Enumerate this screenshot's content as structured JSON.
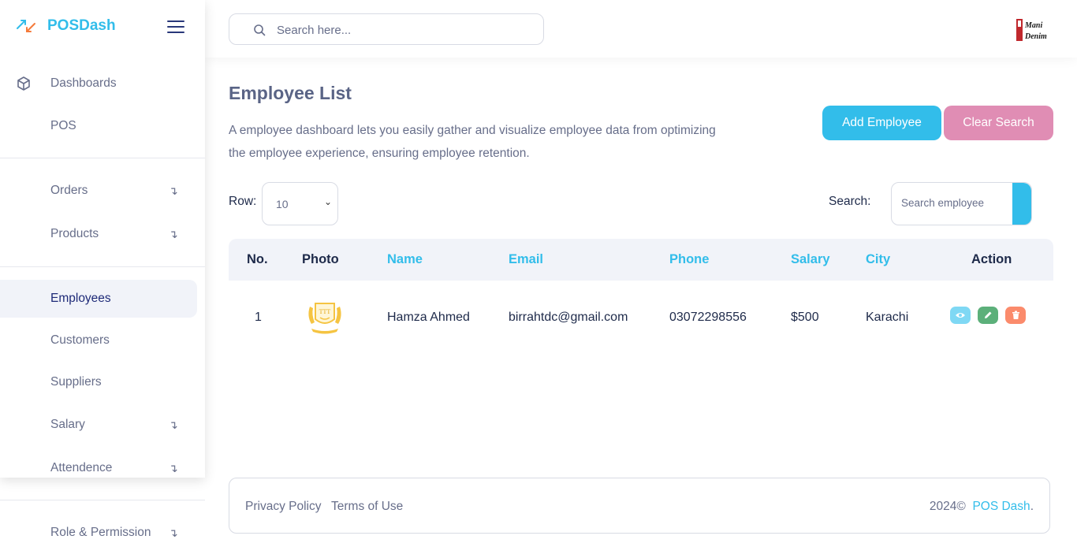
{
  "brand": {
    "name": "POSDash",
    "accent": "#32bdea"
  },
  "sidebar": {
    "items": [
      {
        "label": "Dashboards",
        "arrow": ""
      },
      {
        "label": "POS",
        "arrow": ""
      },
      {
        "label": "Orders",
        "arrow": "↴"
      },
      {
        "label": "Products",
        "arrow": "↴"
      },
      {
        "label": "Employees",
        "arrow": ""
      },
      {
        "label": "Customers",
        "arrow": ""
      },
      {
        "label": "Suppliers",
        "arrow": ""
      },
      {
        "label": "Salary",
        "arrow": "↴"
      },
      {
        "label": "Attendence",
        "arrow": "↴"
      },
      {
        "label": "Role & Permission",
        "arrow": "↴"
      }
    ]
  },
  "topbar": {
    "search_placeholder": "Search here...",
    "avatar_line1": "Mani",
    "avatar_line2": "Denim"
  },
  "page": {
    "title": "Employee List",
    "description": "A employee dashboard lets you easily gather and visualize employee data from optimizing the employee experience, ensuring employee retention.",
    "add_button": "Add Employee",
    "clear_button": "Clear Search",
    "add_color": "#32bdea",
    "clear_color": "#e08db4"
  },
  "controls": {
    "row_label": "Row:",
    "row_value": "10",
    "search_label": "Search:",
    "search_placeholder": "Search employee"
  },
  "table": {
    "headers": [
      "No.",
      "Photo",
      "Name",
      "Email",
      "Phone",
      "Salary",
      "City",
      "Action"
    ],
    "rows": [
      {
        "no": "1",
        "photo_text": "TTT",
        "name": "Hamza Ahmed",
        "email": "birrahtdc@gmail.com",
        "phone": "03072298556",
        "salary": "$500",
        "city": "Karachi"
      }
    ]
  },
  "footer": {
    "privacy": "Privacy Policy",
    "terms": "Terms of Use",
    "copyright": "2024©",
    "brand_link": "POS Dash",
    "period": "."
  }
}
